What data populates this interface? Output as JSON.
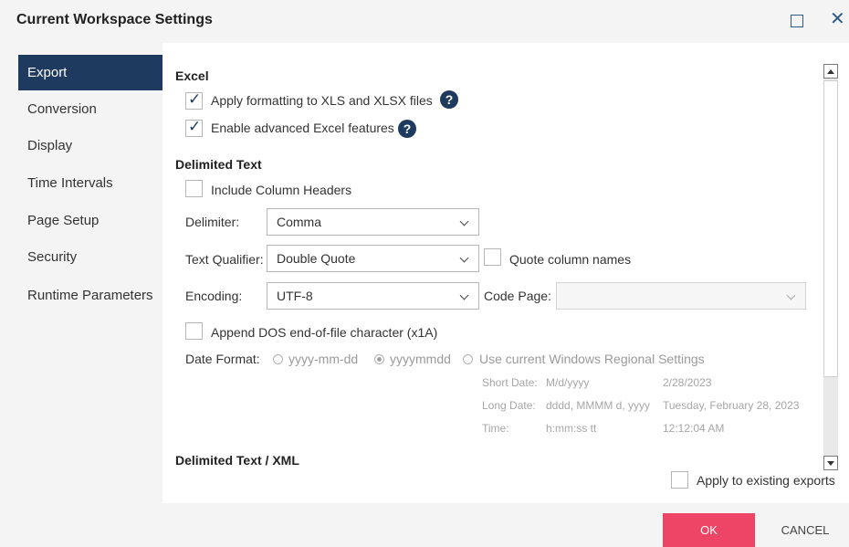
{
  "window": {
    "title": "Current Workspace Settings"
  },
  "sidebar": {
    "items": [
      {
        "label": "Export",
        "active": true
      },
      {
        "label": "Conversion",
        "active": false
      },
      {
        "label": "Display",
        "active": false
      },
      {
        "label": "Time Intervals",
        "active": false
      },
      {
        "label": "Page Setup",
        "active": false
      },
      {
        "label": "Security",
        "active": false
      },
      {
        "label": "Runtime Parameters",
        "active": false
      }
    ]
  },
  "excel": {
    "heading": "Excel",
    "apply_formatting": {
      "label": "Apply formatting to XLS and XLSX files",
      "checked": true
    },
    "advanced_features": {
      "label": "Enable advanced Excel features",
      "checked": true
    },
    "help_glyph": "?"
  },
  "delimited": {
    "heading": "Delimited Text",
    "include_headers": {
      "label": "Include Column Headers",
      "checked": false
    },
    "delimiter": {
      "label": "Delimiter:",
      "value": "Comma"
    },
    "qualifier": {
      "label": "Text Qualifier:",
      "value": "Double Quote"
    },
    "quote_names": {
      "label": "Quote column names",
      "checked": false
    },
    "encoding": {
      "label": "Encoding:",
      "value": "UTF-8"
    },
    "code_page": {
      "label": "Code Page:",
      "value": ""
    },
    "append_dos": {
      "label": "Append DOS end-of-file character (x1A)",
      "checked": false
    },
    "date_format": {
      "label": "Date Format:",
      "options": [
        "yyyy-mm-dd",
        "yyyymmdd",
        "Use current Windows Regional Settings"
      ],
      "selected": "yyyymmdd"
    },
    "regional": {
      "short_date": {
        "label": "Short Date:",
        "pattern": "M/d/yyyy",
        "example": "2/28/2023"
      },
      "long_date": {
        "label": "Long Date:",
        "pattern": "dddd, MMMM d, yyyy",
        "example": "Tuesday, February 28, 2023"
      },
      "time": {
        "label": "Time:",
        "pattern": "h:mm:ss tt",
        "example": "12:12:04 AM"
      }
    }
  },
  "delimited_xml": {
    "heading": "Delimited Text / XML"
  },
  "apply_existing": {
    "label": "Apply to existing exports",
    "checked": false
  },
  "buttons": {
    "ok": "OK",
    "cancel": "CANCEL"
  },
  "colors": {
    "accent": "#1e3a5f",
    "ok_button": "#ee4466",
    "panel_bg": "#f4f4f4"
  }
}
